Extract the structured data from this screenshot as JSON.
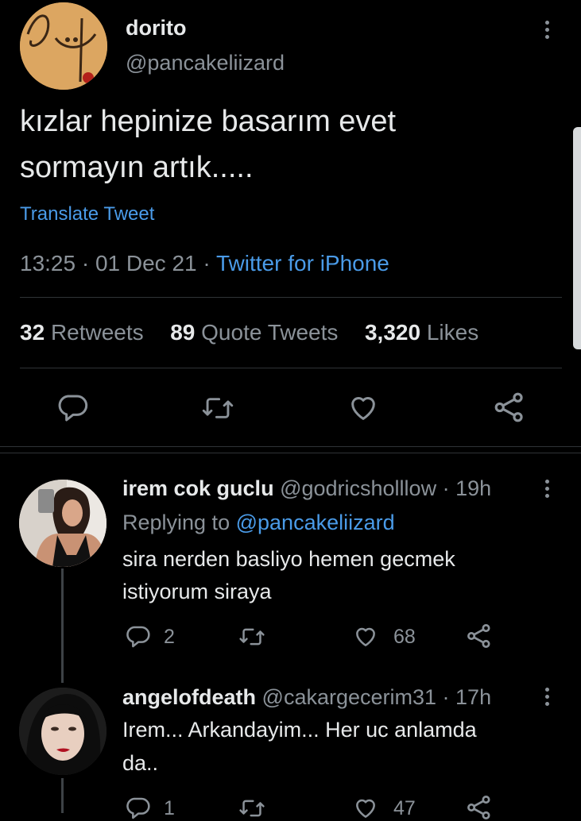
{
  "tweet": {
    "display_name": "dorito",
    "handle": "@pancakeliizard",
    "text_line1": "kızlar hepinize basarım evet",
    "text_line2": "sormayın artık.....",
    "translate": "Translate Tweet",
    "time": "13:25",
    "date": "01 Dec 21",
    "source": "Twitter for iPhone",
    "sep": "·",
    "stats": {
      "retweets_count": "32",
      "retweets_label": "Retweets",
      "quotes_count": "89",
      "quotes_label": "Quote Tweets",
      "likes_count": "3,320",
      "likes_label": "Likes"
    }
  },
  "replies": [
    {
      "display_name": "irem cok guclu",
      "handle": "@godricsholllow",
      "time": "· 19h",
      "replying_to_label": "Replying to",
      "replying_to_handle": "@pancakeliizard",
      "text_line1": "sira nerden basliyo hemen gecmek",
      "text_line2": "istiyorum siraya",
      "reply_count": "2",
      "like_count": "68"
    },
    {
      "display_name": "angelofdeath",
      "handle": "@cakargecerim31",
      "time": "· 17h",
      "text_line1": "Irem... Arkandayim... Her uc anlamda",
      "text_line2": "da..",
      "reply_count": "1",
      "like_count": "47"
    }
  ],
  "colors": {
    "background": "#000000",
    "text": "#e7e9ea",
    "muted": "#8b9299",
    "link": "#4a9be8",
    "divider": "#2f3336"
  },
  "icons": [
    "more-vertical-icon",
    "reply-icon",
    "retweet-icon",
    "like-icon",
    "share-icon"
  ]
}
